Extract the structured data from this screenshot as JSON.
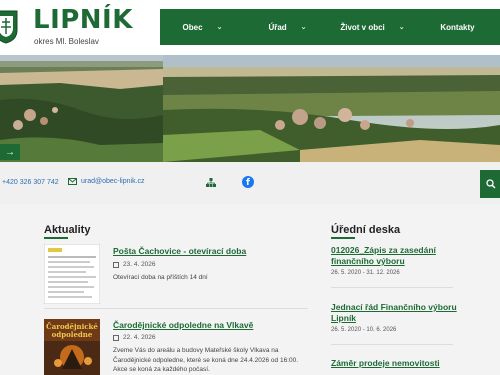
{
  "header": {
    "brand": "LIPNÍK",
    "subtitle": "okres Ml. Boleslav",
    "nav": [
      {
        "label": "Obec",
        "has_dropdown": true
      },
      {
        "label": "Úřad",
        "has_dropdown": true
      },
      {
        "label": "Život v obci",
        "has_dropdown": true
      },
      {
        "label": "Kontakty",
        "has_dropdown": false
      }
    ]
  },
  "contact": {
    "phone": "+420 326 307 742",
    "email": "urad@obec-lipnik.cz"
  },
  "news": {
    "title": "Aktuality",
    "items": [
      {
        "title": "Pošta Čachovice - otevírací doba",
        "date": "23. 4. 2026",
        "text": "Otevírací doba na příštích 14 dní"
      },
      {
        "title": "Čarodějnické odpoledne na Vlkavě",
        "date": "22. 4. 2026",
        "text": "Zveme Vás do areálu a budovy Mateřské školy Vlkava na Čarodějnické odpoledne, které se koná dne 24.4.2026 od 16:00. Akce se koná za každého počasí."
      }
    ]
  },
  "board": {
    "title": "Úřední deska",
    "items": [
      {
        "title": "012026_Zápis za zasedání finančního výboru",
        "date": "26. 5. 2020 - 31. 12. 2026"
      },
      {
        "title": "Jednací řád Finančního výboru Lipník",
        "date": "26. 5. 2020 - 10. 6. 2026"
      },
      {
        "title": "Záměr prodeje nemovitosti",
        "date": ""
      }
    ]
  },
  "colors": {
    "brand_green": "#1e6a35",
    "link_blue": "#2a6fb0"
  },
  "icons": [
    "coat-of-arms",
    "chevron-down-icon",
    "arrow-right-icon",
    "phone-icon",
    "envelope-icon",
    "sitemap-icon",
    "facebook-icon",
    "search-icon",
    "calendar-icon"
  ]
}
